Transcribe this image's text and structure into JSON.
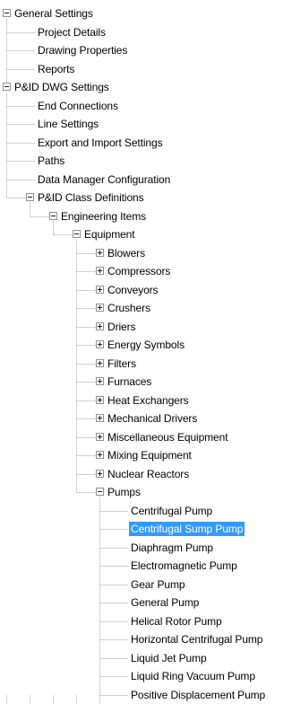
{
  "tree": {
    "nodes": [
      {
        "label": "General Settings",
        "level": 0,
        "expander": "minus"
      },
      {
        "label": "Project Details",
        "level": 1,
        "expander": "none"
      },
      {
        "label": "Drawing Properties",
        "level": 1,
        "expander": "none"
      },
      {
        "label": "Reports",
        "level": 1,
        "expander": "none"
      },
      {
        "label": "P&ID DWG Settings",
        "level": 0,
        "expander": "minus"
      },
      {
        "label": "End Connections",
        "level": 1,
        "expander": "none"
      },
      {
        "label": "Line Settings",
        "level": 1,
        "expander": "none"
      },
      {
        "label": "Export and Import Settings",
        "level": 1,
        "expander": "none"
      },
      {
        "label": "Paths",
        "level": 1,
        "expander": "none"
      },
      {
        "label": "Data Manager Configuration",
        "level": 1,
        "expander": "none"
      },
      {
        "label": "P&ID Class Definitions",
        "level": 1,
        "expander": "minus"
      },
      {
        "label": "Engineering Items",
        "level": 2,
        "expander": "minus"
      },
      {
        "label": "Equipment",
        "level": 3,
        "expander": "minus"
      },
      {
        "label": "Blowers",
        "level": 4,
        "expander": "plus"
      },
      {
        "label": "Compressors",
        "level": 4,
        "expander": "plus"
      },
      {
        "label": "Conveyors",
        "level": 4,
        "expander": "plus"
      },
      {
        "label": "Crushers",
        "level": 4,
        "expander": "plus"
      },
      {
        "label": "Driers",
        "level": 4,
        "expander": "plus"
      },
      {
        "label": "Energy Symbols",
        "level": 4,
        "expander": "plus"
      },
      {
        "label": "Filters",
        "level": 4,
        "expander": "plus"
      },
      {
        "label": "Furnaces",
        "level": 4,
        "expander": "plus"
      },
      {
        "label": "Heat Exchangers",
        "level": 4,
        "expander": "plus"
      },
      {
        "label": "Mechanical Drivers",
        "level": 4,
        "expander": "plus"
      },
      {
        "label": "Miscellaneous Equipment",
        "level": 4,
        "expander": "plus"
      },
      {
        "label": "Mixing Equipment",
        "level": 4,
        "expander": "plus"
      },
      {
        "label": "Nuclear Reactors",
        "level": 4,
        "expander": "plus"
      },
      {
        "label": "Pumps",
        "level": 4,
        "expander": "minus"
      },
      {
        "label": "Centrifugal Pump",
        "level": 5,
        "expander": "none"
      },
      {
        "label": "Centrifugal Sump Pump",
        "level": 5,
        "expander": "none",
        "selected": true
      },
      {
        "label": "Diaphragm Pump",
        "level": 5,
        "expander": "none"
      },
      {
        "label": "Electromagnetic Pump",
        "level": 5,
        "expander": "none"
      },
      {
        "label": "Gear Pump",
        "level": 5,
        "expander": "none"
      },
      {
        "label": "General Pump",
        "level": 5,
        "expander": "none"
      },
      {
        "label": "Helical Rotor Pump",
        "level": 5,
        "expander": "none"
      },
      {
        "label": "Horizontal Centrifugal Pump",
        "level": 5,
        "expander": "none"
      },
      {
        "label": "Liquid Jet Pump",
        "level": 5,
        "expander": "none"
      },
      {
        "label": "Liquid Ring Vacuum Pump",
        "level": 5,
        "expander": "none"
      },
      {
        "label": "Positive Displacement Pump",
        "level": 5,
        "expander": "none"
      }
    ],
    "colors": {
      "selection": "#3399ff",
      "selection_text": "#ffffff",
      "guide_line": "#a0a0a0"
    }
  }
}
